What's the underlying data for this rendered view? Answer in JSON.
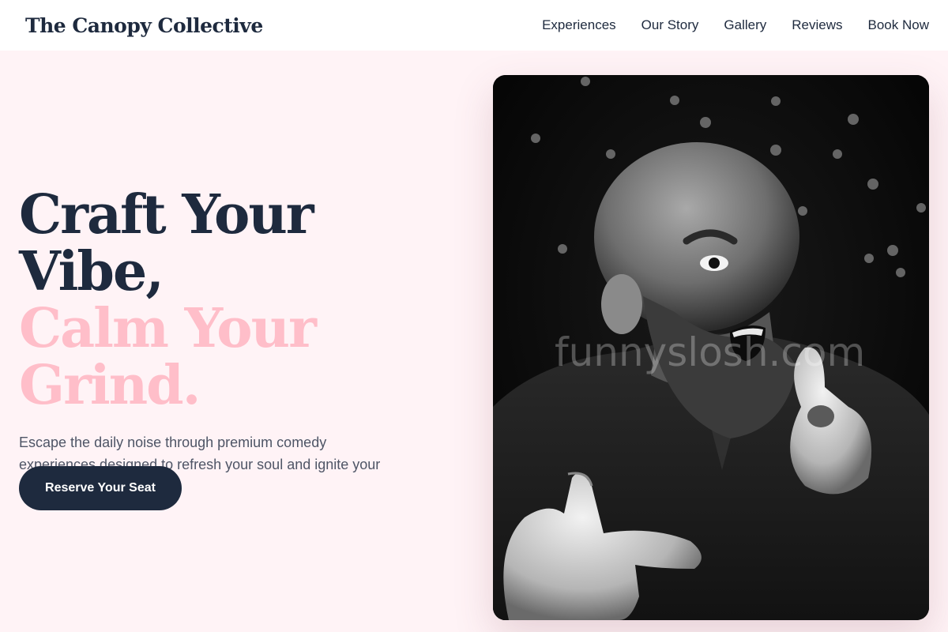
{
  "brand": {
    "name": "The Canopy Collective"
  },
  "nav": {
    "items": [
      {
        "label": "Experiences"
      },
      {
        "label": "Our Story"
      },
      {
        "label": "Gallery"
      },
      {
        "label": "Reviews"
      },
      {
        "label": "Book Now"
      }
    ]
  },
  "hero": {
    "headline_line1": "Craft Your Vibe,",
    "headline_line2": "Calm Your Grind.",
    "subtitle": "Escape the daily noise through premium comedy experiences designed to refresh your soul and ignite your spirit.",
    "cta_label": "Reserve Your Seat"
  },
  "photo": {
    "watermark": "funnyslosh.com",
    "description": "black-and-white photo of bearded man pointing at camera"
  },
  "colors": {
    "background": "#fff3f6",
    "navy": "#1e2a3e",
    "pink": "#ffbec9",
    "body_text": "#4e5566"
  }
}
